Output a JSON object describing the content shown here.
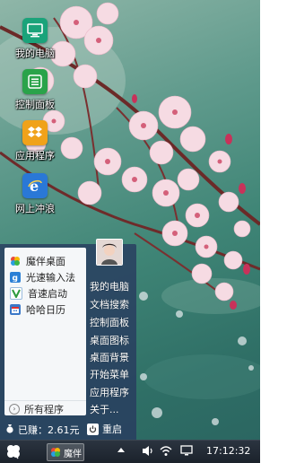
{
  "desktop": {
    "icons": [
      {
        "label": "我的电脑",
        "icon": "monitor-icon",
        "color": "#1aa37a"
      },
      {
        "label": "控制面板",
        "icon": "list-panel-icon",
        "color": "#2aa34a"
      },
      {
        "label": "应用程序",
        "icon": "dropbox-icon",
        "color": "#f0a21a"
      },
      {
        "label": "网上冲浪",
        "icon": "ie-icon",
        "color": "#2a78d6"
      }
    ]
  },
  "start_menu": {
    "apps": [
      {
        "label": "魔伴桌面",
        "icon": "mobanzhuomian-icon"
      },
      {
        "label": "光速输入法",
        "icon": "ime-icon"
      },
      {
        "label": "音速启动",
        "icon": "vstart-icon"
      },
      {
        "label": "哈哈日历",
        "icon": "calendar-icon"
      }
    ],
    "all_programs": "所有程序",
    "links": [
      "我的电脑",
      "文档搜索",
      "控制面板",
      "桌面图标",
      "桌面背景",
      "开始菜单",
      "应用程序",
      "关于..."
    ],
    "earned": "已赚：2.61元",
    "restart": "重启"
  },
  "taskbar": {
    "task_label": "魔伴",
    "clock": "17:12:32"
  },
  "colors": {
    "taskbar_bg": "#222a34",
    "menu_bg": "#283c5f",
    "accent": "#2a78d6"
  }
}
